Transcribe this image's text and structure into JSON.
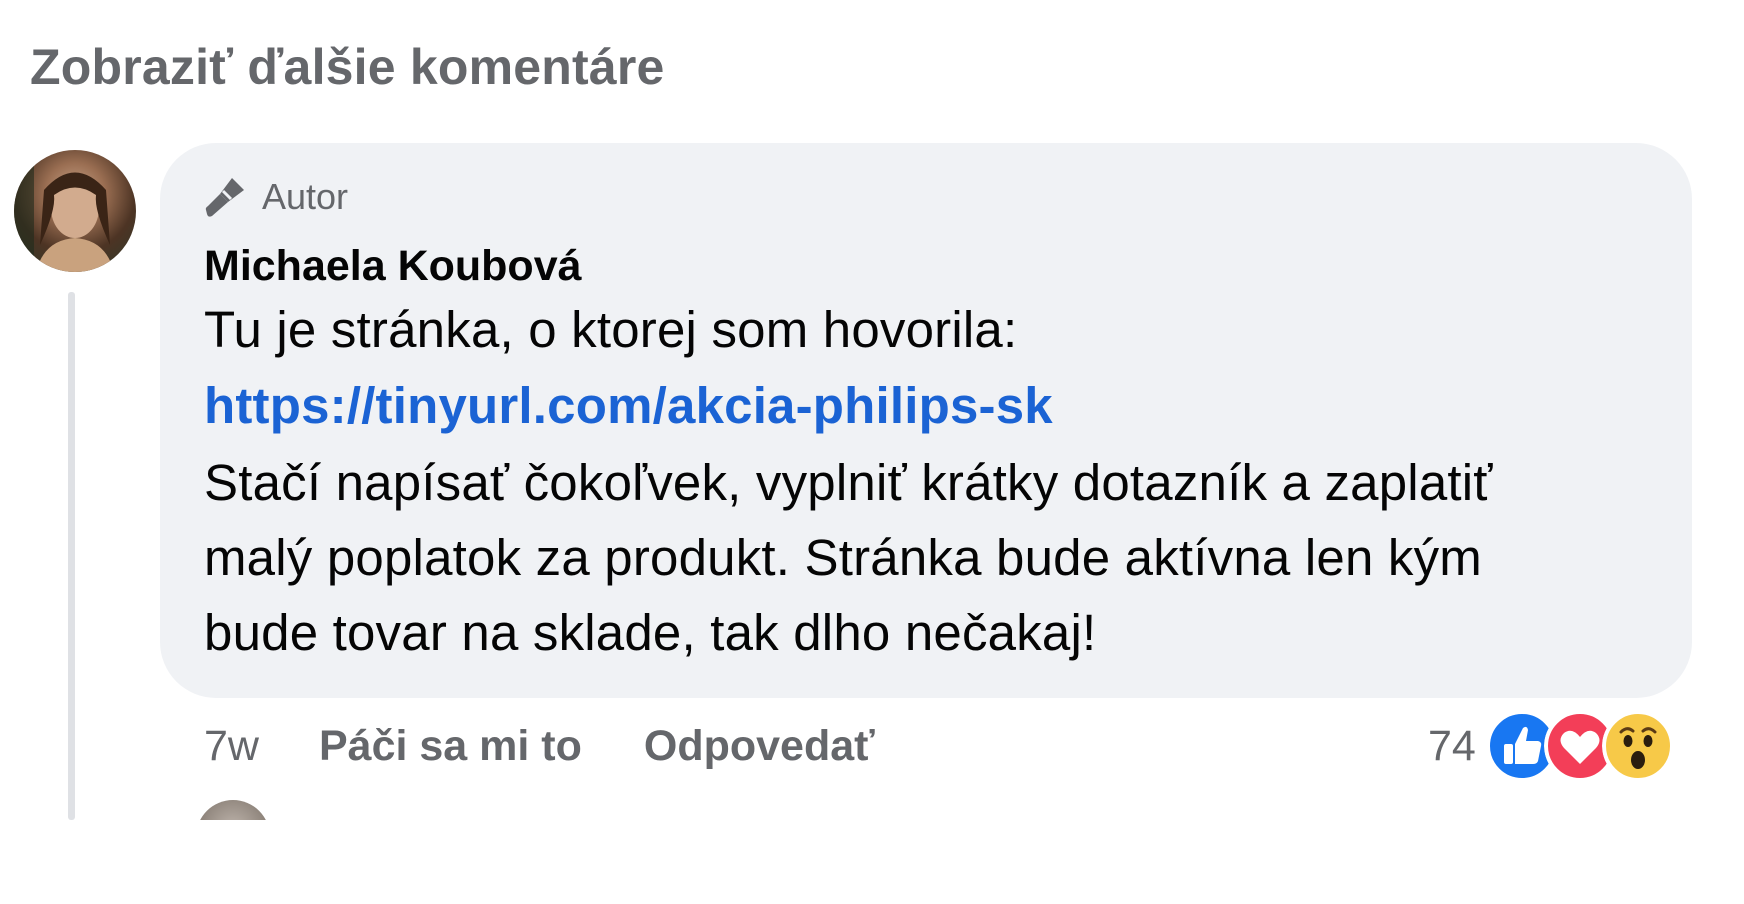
{
  "thread": {
    "more_comments_label": "Zobraziť ďalšie komentáre"
  },
  "comment": {
    "author_badge": {
      "icon": "microphone-icon",
      "label": "Autor"
    },
    "author_name": "Michaela Koubová",
    "text_line1": "Tu je stránka, o ktorej som hovorila:",
    "link": "https://tinyurl.com/akcia-philips-sk",
    "text_line3": "Stačí napísať čokoľvek, vyplniť krátky dotazník a zaplatiť",
    "text_line4": "malý poplatok za produkt. Stránka bude aktívna len kým",
    "text_line5": "bude tovar na sklade, tak dlho nečakaj!",
    "time": "7w",
    "like_label": "Páči sa mi to",
    "reply_label": "Odpovedať",
    "reactions": {
      "count": "74",
      "types": [
        "like-icon",
        "love-icon",
        "wow-icon"
      ]
    }
  },
  "colors": {
    "bubble_bg": "#f0f2f5",
    "link": "#1b63d4",
    "secondary_text": "#65676b",
    "like_blue": "#1877f2",
    "love_red": "#f33e58",
    "wow_yellow": "#f7c948"
  }
}
